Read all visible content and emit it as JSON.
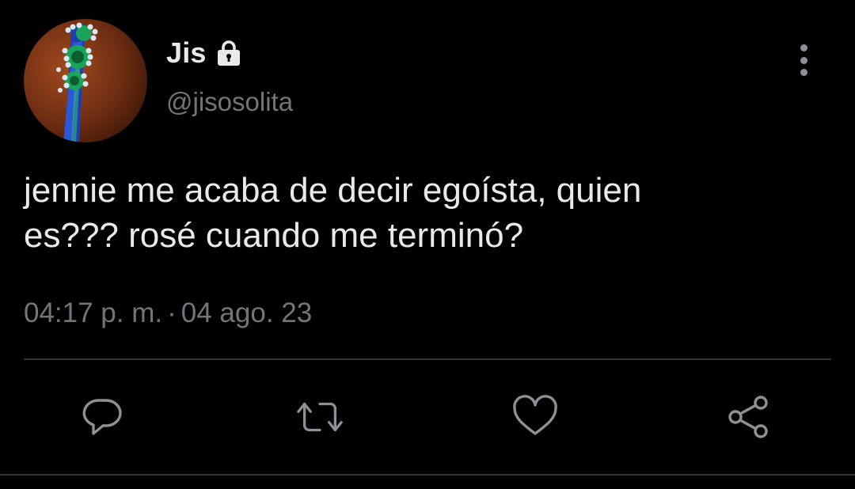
{
  "tweet": {
    "display_name": "Jis",
    "handle": "@jisosolita",
    "protected": true,
    "text": "jennie me acaba de decir egoísta, quien\nes??? rosé cuando me terminó?",
    "time": "04:17 p. m.",
    "separator": "·",
    "date": "04 ago. 23"
  },
  "icons": {
    "lock": "lock-icon",
    "more": "more-vertical-icon",
    "reply": "reply-icon",
    "retweet": "retweet-icon",
    "like": "heart-icon",
    "share": "share-icon"
  },
  "colors": {
    "background": "#000000",
    "primary_text": "#e7e9ea",
    "secondary_text": "#71767b",
    "divider": "#2f3336"
  }
}
